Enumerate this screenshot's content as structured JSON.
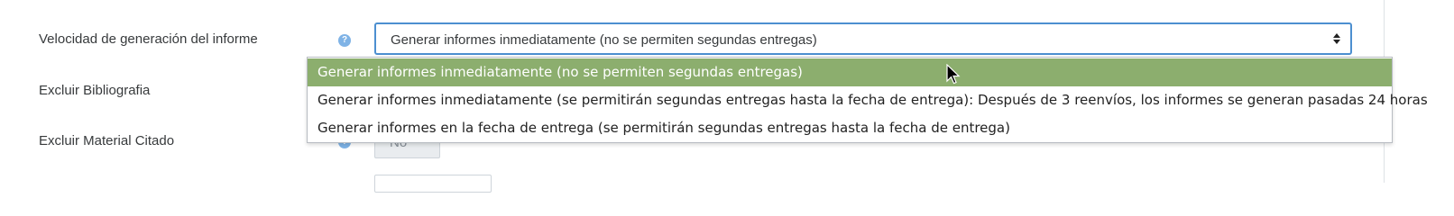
{
  "form": {
    "report_speed": {
      "label": "Velocidad de generación del informe",
      "help_icon": "question-circle-icon",
      "selected_value": "Generar informes inmediatamente (no se permiten segundas entregas)"
    },
    "exclude_bibliography": {
      "label": "Excluir Bibliografia"
    },
    "exclude_quoted": {
      "label": "Excluir Material Citado",
      "help_icon": "question-circle-icon",
      "value": "No"
    }
  },
  "dropdown": {
    "options": [
      "Generar informes inmediatamente (no se permiten segundas entregas)",
      "Generar informes inmediatamente (se permitirán segundas entregas hasta la fecha de entrega): Después de 3 reenvíos, los informes se generan pasadas 24 horas",
      "Generar informes en la fecha de entrega (se permitirán segundas entregas hasta la fecha de entrega)"
    ],
    "selected_index": 0
  },
  "colors": {
    "focus_border": "#4c8fd0",
    "selected_option_bg": "#8cae6e",
    "help_icon": "#7fb3e6"
  }
}
